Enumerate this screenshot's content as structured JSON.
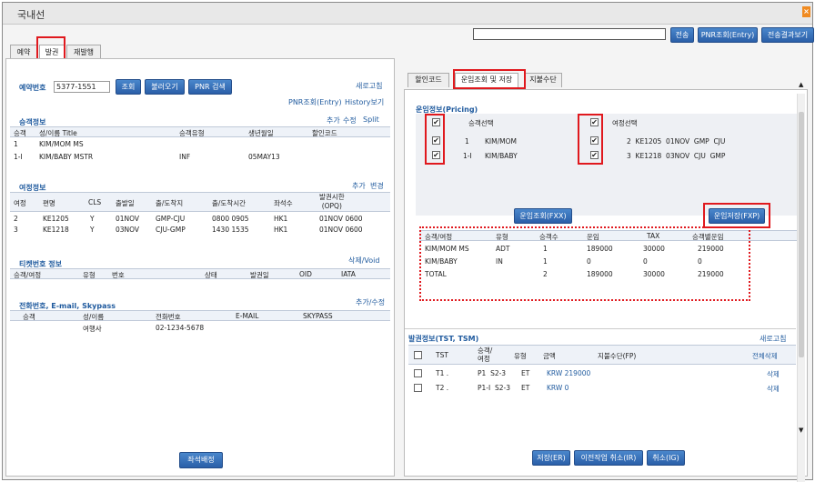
{
  "window": {
    "title": "국내선"
  },
  "cmdbar": {
    "input_value": "",
    "send": "전송",
    "pnr_entry": "PNR조회(Entry)",
    "send_result": "전송결과보기"
  },
  "tabs": [
    "예약",
    "발권",
    "재발행"
  ],
  "left": {
    "res_no_label": "예약번호",
    "res_no_value": "5377-1551",
    "btn_query": "조회",
    "btn_load": "불러오기",
    "btn_pnr": "PNR 검색",
    "refresh": "새로고침",
    "pnr_entry": "PNR조회(Entry)",
    "history": "History보기",
    "pax": {
      "title": "승객정보",
      "actions": [
        "추가",
        "수정",
        "Split"
      ],
      "headers": [
        "승객",
        "성/이름 Title",
        "승객유형",
        "생년월일",
        "할인코드"
      ],
      "rows": [
        [
          "1",
          "KIM/MOM  MS",
          "",
          "",
          ""
        ],
        [
          "1-I",
          "KIM/BABY  MSTR",
          "INF",
          "05MAY13",
          ""
        ]
      ]
    },
    "itin": {
      "title": "여정정보",
      "actions": [
        "추가",
        "변경"
      ],
      "headers": [
        "여정",
        "편명",
        "CLS",
        "출발일",
        "출/도착지",
        "출/도착시간",
        "좌석수",
        "발권시한\n(OPQ)"
      ],
      "rows": [
        [
          "2",
          "KE1205",
          "Y",
          "01NOV",
          "GMP-CJU",
          "0800 0905",
          "HK1",
          "01NOV 0600"
        ],
        [
          "3",
          "KE1218",
          "Y",
          "03NOV",
          "CJU-GMP",
          "1430 1535",
          "HK1",
          "01NOV 0600"
        ]
      ]
    },
    "ticket": {
      "title": "티켓번호 정보",
      "action": "삭제/Void",
      "headers": [
        "승객/여정",
        "유형",
        "번호",
        "상태",
        "발권일",
        "OID",
        "IATA"
      ]
    },
    "contact": {
      "title": "전화번호, E-mail, Skypass",
      "action": "추가/수정",
      "headers": [
        "승객",
        "성/이름",
        "전화번호",
        "E-MAIL",
        "SKYPASS"
      ],
      "row": [
        "",
        "여행사",
        "02-1234-5678",
        "",
        ""
      ]
    },
    "seat_btn": "좌석배정"
  },
  "right": {
    "tabs": [
      "할인코드",
      "운임조회 및 저장",
      "지불수단"
    ],
    "pricing_title": "운임정보(Pricing)",
    "pax_col": "승객선택",
    "itin_col": "여정선택",
    "pax_rows": [
      [
        "1",
        "KIM/MOM"
      ],
      [
        "1-I",
        "KIM/BABY"
      ]
    ],
    "itin_rows": [
      "2  KE1205  01NOV  GMP  CJU",
      "3  KE1218  03NOV  CJU  GMP"
    ],
    "btn_fxx": "운임조회(FXX)",
    "btn_fxp": "운임저장(FXP)",
    "fare_headers": [
      "승객/여정",
      "유형",
      "승객수",
      "운임",
      "TAX",
      "승객별운임"
    ],
    "fare_rows": [
      [
        "KIM/MOM MS",
        "ADT",
        "1",
        "189000",
        "30000",
        "219000"
      ],
      [
        "KIM/BABY",
        "IN",
        "1",
        "0",
        "0",
        "0"
      ],
      [
        "TOTAL",
        "",
        "2",
        "189000",
        "30000",
        "219000"
      ]
    ],
    "tst_title": "발권정보(TST, TSM)",
    "tst_refresh": "새로고침",
    "tst_headers": [
      "TST",
      "승객/여정",
      "유형",
      "금액",
      "지불수단(FP)",
      "전체삭제"
    ],
    "tst_rows": [
      [
        "T1 .",
        "P1  S2-3",
        "ET",
        "KRW 219000",
        "",
        "삭제"
      ],
      [
        "T2 .",
        "P1-I  S2-3",
        "ET",
        "KRW 0",
        "",
        "삭제"
      ]
    ],
    "btn_er": "저장(ER)",
    "btn_ir": "이전작업 취소(IR)",
    "btn_ig": "취소(IG)"
  },
  "colors": {
    "accent": "#1f5a9e",
    "button": "#2f6bb3",
    "highlight": "#e0191e"
  }
}
